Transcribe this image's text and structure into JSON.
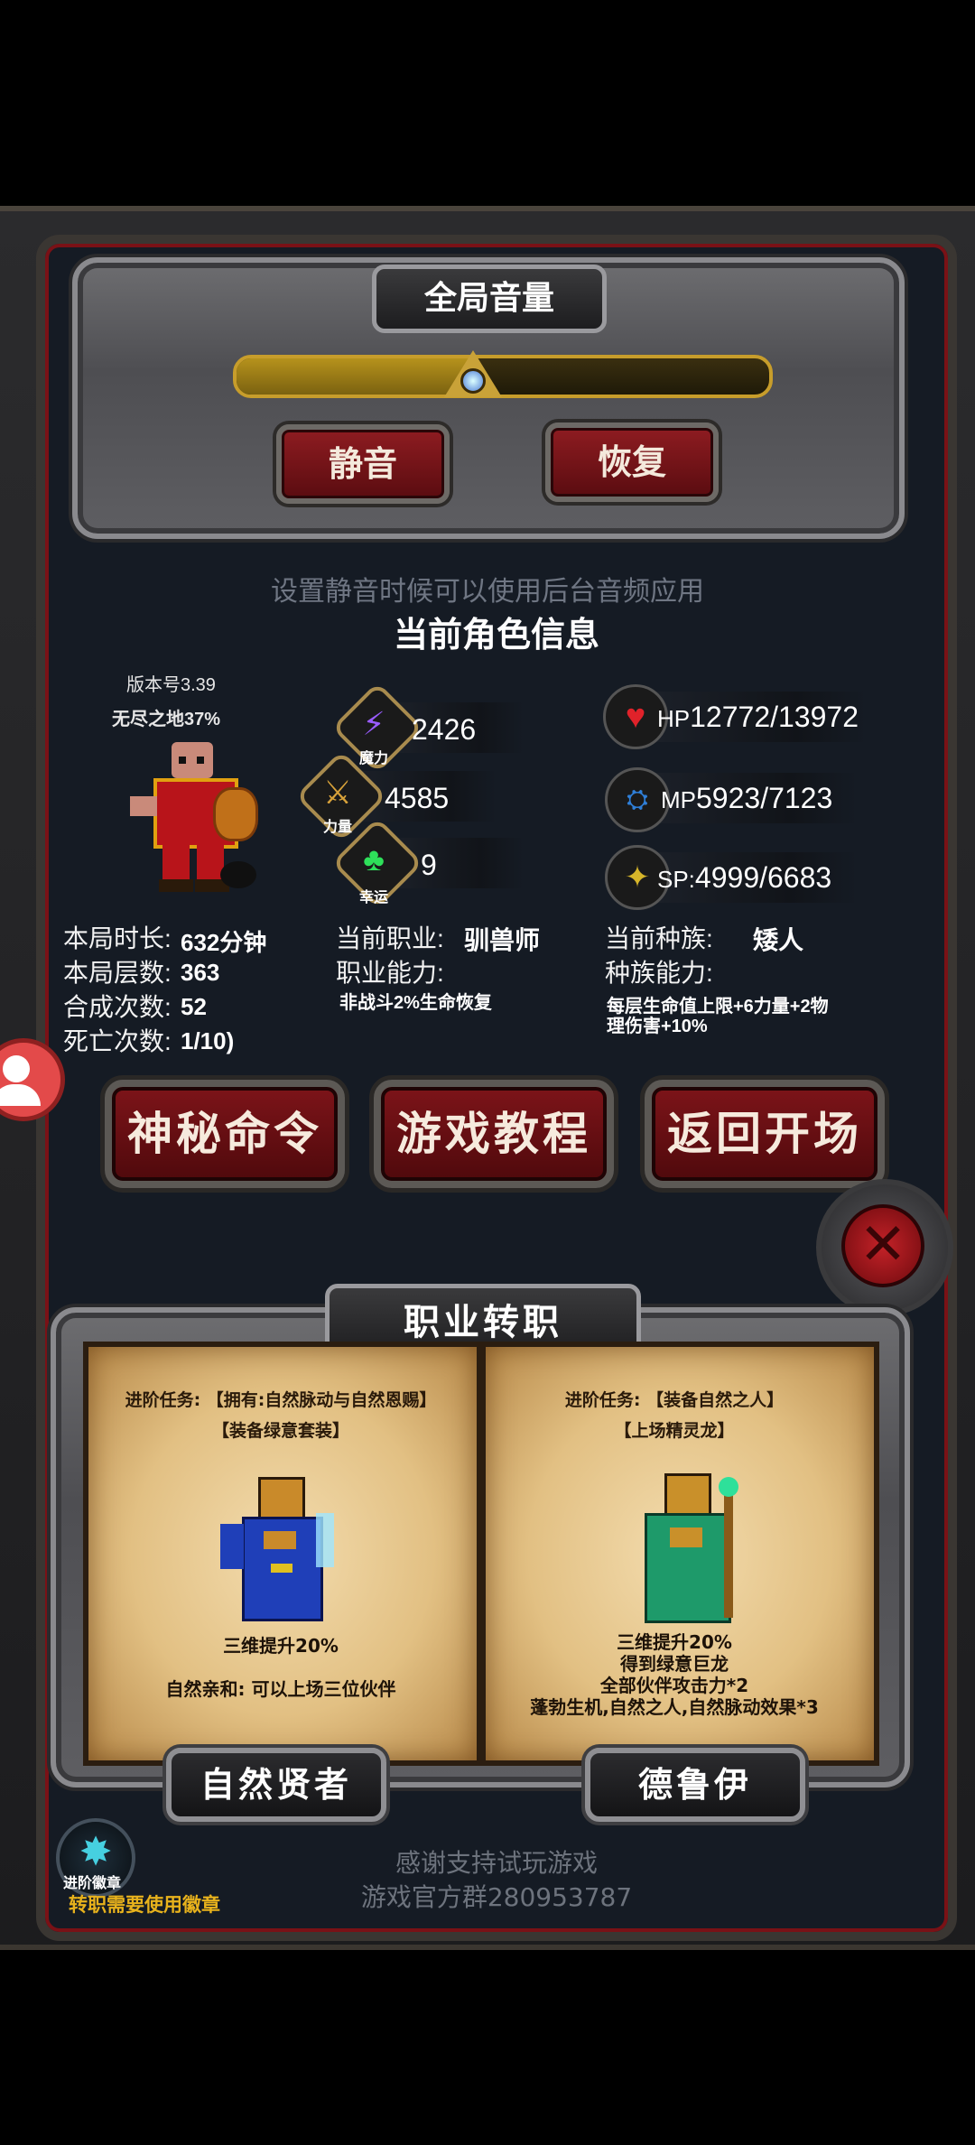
{
  "volume": {
    "title": "全局音量",
    "level_fraction": 0.45,
    "mute_label": "静音",
    "restore_label": "恢复",
    "hint": "设置静音时候可以使用后台音频应用"
  },
  "character": {
    "section_title": "当前角色信息",
    "version": "版本号3.39",
    "mode": "无尽之地37%",
    "stats": {
      "magic": {
        "value": "2426",
        "caption": "魔力"
      },
      "strength": {
        "value": "4585",
        "caption": "力量"
      },
      "luck": {
        "value": "9",
        "caption": "幸运"
      }
    },
    "hp": {
      "label": "HP",
      "value": "12772/13972"
    },
    "mp": {
      "label": "MP",
      "value": "5923/7123"
    },
    "sp": {
      "label": "SP:",
      "value": "4999/6683"
    },
    "play_time_label": "本局时长:",
    "play_time_value": "632分钟",
    "floors_label": "本局层数:",
    "floors_value": "363",
    "crafts_label": "合成次数:",
    "crafts_value": "52",
    "deaths_label": "死亡次数:",
    "deaths_value": "1/10)",
    "class_label": "当前职业:",
    "class_value": "驯兽师",
    "class_ability_label": "职业能力:",
    "class_ability_value": "非战斗2%生命恢复",
    "race_label": "当前种族:",
    "race_value": "矮人",
    "race_ability_label": "种族能力:",
    "race_ability_value": "每层生命值上限+6力量+2物理伤害+10%"
  },
  "buttons": {
    "secret_command": "神秘命令",
    "tutorial": "游戏教程",
    "back_to_start": "返回开场"
  },
  "job_change": {
    "title": "职业转职",
    "left": {
      "quest_line1": "进阶任务: 【拥有:自然脉动与自然恩赐】",
      "quest_line2": "【装备绿意套装】",
      "bonus1": "三维提升20%",
      "bonus2": "自然亲和: 可以上场三位伙伴",
      "name": "自然贤者"
    },
    "right": {
      "quest_line1": "进阶任务: 【装备自然之人】",
      "quest_line2": "【上场精灵龙】",
      "bonus1": "三维提升20%",
      "bonus2": "得到绿意巨龙",
      "bonus3": "全部伙伴攻击力*2",
      "bonus4": "蓬勃生机,自然之人,自然脉动效果*3",
      "name": "德鲁伊"
    },
    "badge_label": "进阶徽章",
    "badge_hint": "转职需要使用徽章"
  },
  "footer": {
    "line1": "感谢支持试玩游戏",
    "line2": "游戏官方群280953787"
  },
  "colors": {
    "accent_red": "#8e1c21",
    "gold": "#c79d2b",
    "panel_bg": "#151b24"
  }
}
